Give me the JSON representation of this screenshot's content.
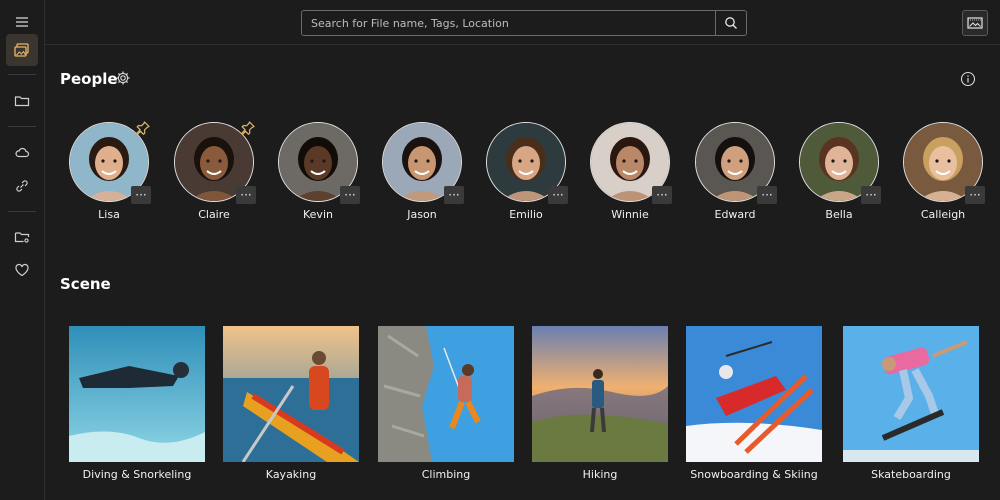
{
  "search": {
    "placeholder": "Search for File name, Tags, Location"
  },
  "people": {
    "title": "People",
    "items": [
      {
        "name": "Lisa",
        "pinned": true
      },
      {
        "name": "Claire",
        "pinned": true
      },
      {
        "name": "Kevin",
        "pinned": false
      },
      {
        "name": "Jason",
        "pinned": false
      },
      {
        "name": "Emilio",
        "pinned": false
      },
      {
        "name": "Winnie",
        "pinned": false
      },
      {
        "name": "Edward",
        "pinned": false
      },
      {
        "name": "Bella",
        "pinned": false
      },
      {
        "name": "Calleigh",
        "pinned": false
      }
    ],
    "more_label": "···"
  },
  "scene": {
    "title": "Scene",
    "items": [
      {
        "name": "Diving & Snorkeling"
      },
      {
        "name": "Kayaking"
      },
      {
        "name": "Climbing"
      },
      {
        "name": "Hiking"
      },
      {
        "name": "Snowboarding & Skiing"
      },
      {
        "name": "Skateboarding"
      }
    ]
  },
  "icons": {
    "rail": [
      "hamburger-menu-icon",
      "photos-gallery-icon",
      "folder-icon",
      "cloud-icon",
      "link-icon",
      "location-folder-icon",
      "heart-icon"
    ],
    "top": [
      "search-icon",
      "slideshow-icon"
    ],
    "people": [
      "gear-icon",
      "info-icon",
      "pin-icon",
      "more-icon"
    ]
  },
  "colors": {
    "background": "#1c1c1c",
    "accent": "#e8b86a",
    "active_rail": "#3b3530"
  }
}
